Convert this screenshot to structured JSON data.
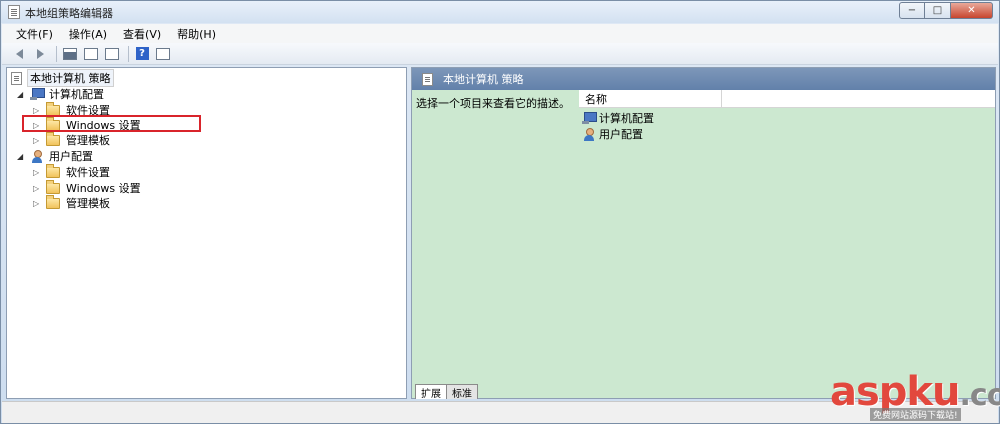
{
  "window": {
    "title": "本地组策略编辑器",
    "controls": {
      "minimize": "−",
      "maximize": "□",
      "close": "✕"
    }
  },
  "menu": [
    "文件(F)",
    "操作(A)",
    "查看(V)",
    "帮助(H)"
  ],
  "toolbar": {
    "icons": [
      "back-arrow-icon",
      "forward-arrow-icon",
      "show-hide-tree-icon",
      "properties-icon",
      "export-list-icon",
      "help-icon",
      "view-icon"
    ],
    "help_glyph": "?"
  },
  "tree": {
    "root": "本地计算机 策略",
    "nodes": [
      {
        "label": "计算机配置",
        "icon": "computer-icon",
        "expanded": true,
        "children": [
          "软件设置",
          "Windows 设置",
          "管理模板"
        ]
      },
      {
        "label": "用户配置",
        "icon": "user-icon",
        "expanded": true,
        "children": [
          "软件设置",
          "Windows 设置",
          "管理模板"
        ]
      }
    ],
    "highlighted": "Windows 设置"
  },
  "right_pane": {
    "header": "本地计算机 策略",
    "description": "选择一个项目来查看它的描述。",
    "column_name": "名称",
    "items": [
      "计算机配置",
      "用户配置"
    ],
    "tabs": [
      "扩展",
      "标准"
    ]
  },
  "colors": {
    "highlight_border": "#d9242b",
    "right_pane_bg": "#cce8d0",
    "header_bg": "#6e8bb2"
  },
  "watermark": {
    "brand": "aspku",
    "suffix": ".com",
    "subtitle": "免费网站源码下载站!"
  }
}
